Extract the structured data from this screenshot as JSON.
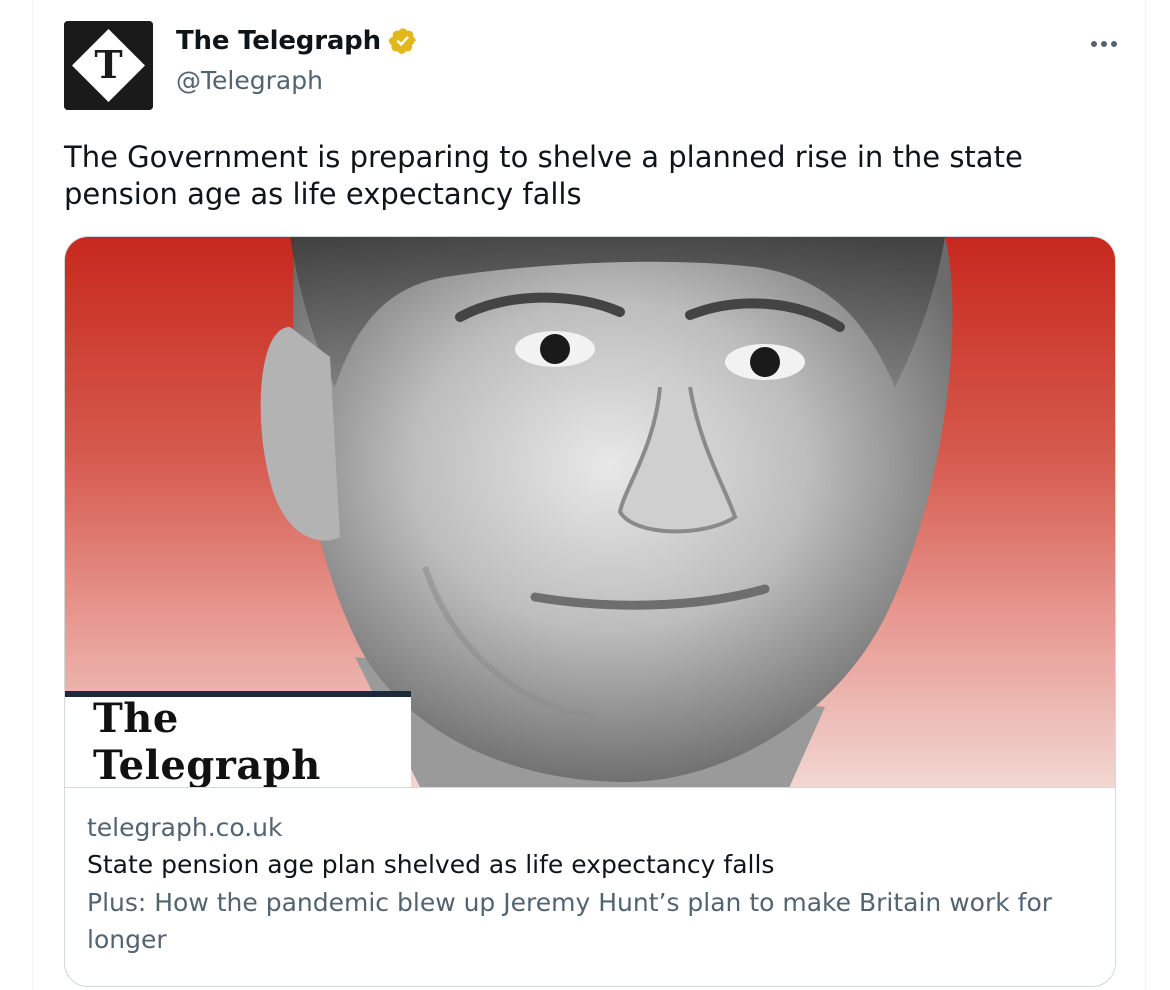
{
  "tweet": {
    "author": {
      "display_name": "The Telegraph",
      "handle": "@Telegraph",
      "verified_color": "#e2b719"
    },
    "more_icon": "more-horizontal-icon",
    "text": "The Government is preparing to shelve a planned rise in the state pension age as life expectancy falls",
    "card": {
      "image_logo": "The Telegraph",
      "domain": "telegraph.co.uk",
      "title": "State pension age plan shelved as life expectancy falls",
      "description": "Plus: How the pandemic blew up Jeremy Hunt’s plan to make Britain work for longer"
    }
  },
  "colors": {
    "text_primary": "#0f1419",
    "text_secondary": "#536471",
    "border": "#cfd9de",
    "image_red": "#c7281d"
  }
}
